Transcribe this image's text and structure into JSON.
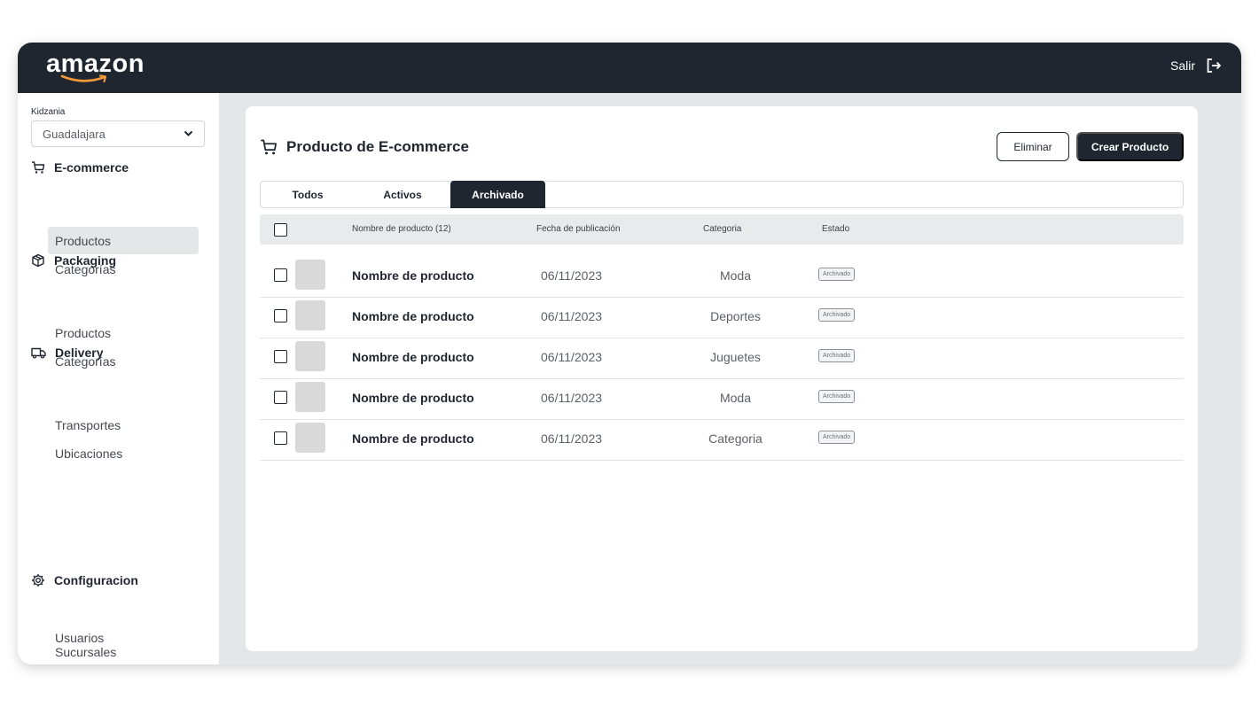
{
  "header": {
    "logo_text": "amazon",
    "logout_label": "Salir",
    "logout_icon": "logout-icon",
    "colors": {
      "bar": "#1f2630",
      "logo_smile": "#f29a38"
    }
  },
  "sidebar": {
    "org_label": "Kidzania",
    "location_select": {
      "value": "Guadalajara",
      "icon": "chevron-down-icon"
    },
    "sections": [
      {
        "label": "E-commerce",
        "icon": "cart-icon",
        "items": [
          {
            "label": "Productos",
            "active": true
          },
          {
            "label": "Categorías"
          }
        ]
      },
      {
        "label": "Packaging",
        "icon": "box-icon",
        "items": [
          {
            "label": "Productos"
          },
          {
            "label": "Categorías"
          }
        ]
      },
      {
        "label": "Delivery",
        "icon": "truck-icon",
        "items": [
          {
            "label": "Transportes"
          },
          {
            "label": "Ubicaciones"
          }
        ]
      },
      {
        "label": "Configuracion",
        "icon": "settings-icon",
        "items": [
          {
            "label": "Sucursales"
          },
          {
            "label": "Usuarios"
          }
        ]
      }
    ]
  },
  "main": {
    "title": "Producto de E-commerce",
    "title_icon": "cart-icon",
    "delete_label": "Eliminar",
    "create_label": "Crear Producto",
    "tabs": [
      {
        "label": "Todos"
      },
      {
        "label": "Activos"
      },
      {
        "label": "Archivado",
        "active": true
      }
    ],
    "table": {
      "columns": [
        "Nombre de producto (12)",
        "Fecha de publicación",
        "Categoria",
        "Estado"
      ],
      "rows": [
        {
          "name": "Nombre de producto",
          "date": "06/11/2023",
          "category": "Moda",
          "status": "Archivado"
        },
        {
          "name": "Nombre de producto",
          "date": "06/11/2023",
          "category": "Deportes",
          "status": "Archivado"
        },
        {
          "name": "Nombre de producto",
          "date": "06/11/2023",
          "category": "Juguetes",
          "status": "Archivado"
        },
        {
          "name": "Nombre de producto",
          "date": "06/11/2023",
          "category": "Moda",
          "status": "Archivado"
        },
        {
          "name": "Nombre de producto",
          "date": "06/11/2023",
          "category": "Categoria",
          "status": "Archivado"
        }
      ]
    }
  }
}
